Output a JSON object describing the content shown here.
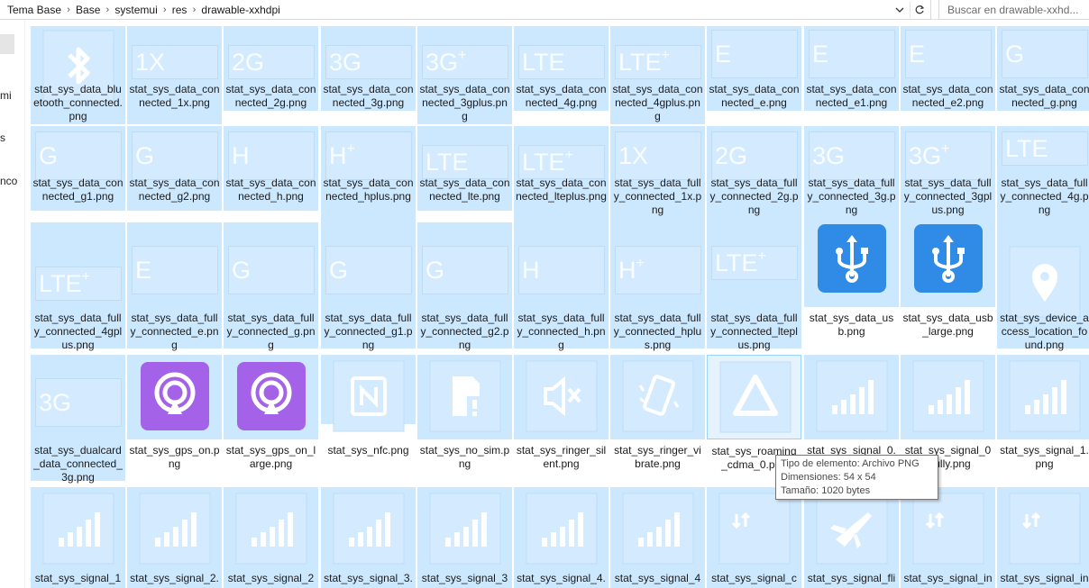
{
  "breadcrumb": [
    "Tema Base",
    "Base",
    "systemui",
    "res",
    "drawable-xxhdpi"
  ],
  "search_placeholder": "Buscar en drawable-xxhd...",
  "nav_fragments": [
    "mi",
    "s",
    "nco"
  ],
  "files": [
    {
      "name": "stat_sys_data_bluetooth_connected.png",
      "icon": "bluetooth-icon"
    },
    {
      "name": "stat_sys_data_connected_1x.png",
      "label": "1X"
    },
    {
      "name": "stat_sys_data_connected_2g.png",
      "label": "2G"
    },
    {
      "name": "stat_sys_data_connected_3g.png",
      "label": "3G"
    },
    {
      "name": "stat_sys_data_connected_3gplus.png",
      "label": "3G",
      "plus": true
    },
    {
      "name": "stat_sys_data_connected_4g.png",
      "label": "LTE"
    },
    {
      "name": "stat_sys_data_connected_4gplus.png",
      "label": "LTE",
      "plus": true
    },
    {
      "name": "stat_sys_data_connected_e.png",
      "label": "E"
    },
    {
      "name": "stat_sys_data_connected_e1.png",
      "label": "E"
    },
    {
      "name": "stat_sys_data_connected_e2.png",
      "label": "E"
    },
    {
      "name": "stat_sys_data_connected_g.png",
      "label": "G"
    },
    {
      "name": "stat_sys_data_connected_g1.png",
      "label": "G"
    },
    {
      "name": "stat_sys_data_connected_g2.png",
      "label": "G"
    },
    {
      "name": "stat_sys_data_connected_h.png",
      "label": "H"
    },
    {
      "name": "stat_sys_data_connected_hplus.png",
      "label": "H",
      "plus": true
    },
    {
      "name": "stat_sys_data_connected_lte.png",
      "label": "LTE"
    },
    {
      "name": "stat_sys_data_connected_lteplus.png",
      "label": "LTE",
      "plus": true
    },
    {
      "name": "stat_sys_data_fully_connected_1x.png",
      "label": "1X"
    },
    {
      "name": "stat_sys_data_fully_connected_2g.png",
      "label": "2G"
    },
    {
      "name": "stat_sys_data_fully_connected_3g.png",
      "label": "3G"
    },
    {
      "name": "stat_sys_data_fully_connected_3gplus.png",
      "label": "3G",
      "plus": true
    },
    {
      "name": "stat_sys_data_fully_connected_4g.png",
      "label": "LTE"
    },
    {
      "name": "stat_sys_data_fully_connected_4gplus.png",
      "label": "LTE",
      "plus": true
    },
    {
      "name": "stat_sys_data_fully_connected_e.png",
      "label": "E"
    },
    {
      "name": "stat_sys_data_fully_connected_g.png",
      "label": "G"
    },
    {
      "name": "stat_sys_data_fully_connected_g1.png",
      "label": "G"
    },
    {
      "name": "stat_sys_data_fully_connected_g2.png",
      "label": "G"
    },
    {
      "name": "stat_sys_data_fully_connected_h.png",
      "label": "H"
    },
    {
      "name": "stat_sys_data_fully_connected_hplus.png",
      "label": "H",
      "plus": true
    },
    {
      "name": "stat_sys_data_fully_connected_lteplus.png",
      "label": "LTE",
      "plus": true
    },
    {
      "name": "stat_sys_data_usb.png",
      "icon": "usb-icon"
    },
    {
      "name": "stat_sys_data_usb_large.png",
      "icon": "usb-icon"
    },
    {
      "name": "stat_sys_device_access_location_found.png",
      "icon": "location-pin-icon"
    },
    {
      "name": "stat_sys_dualcard_data_connected_3g.png",
      "label": "3G"
    },
    {
      "name": "stat_sys_gps_on.png",
      "icon": "gps-icon"
    },
    {
      "name": "stat_sys_gps_on_large.png",
      "icon": "gps-icon"
    },
    {
      "name": "stat_sys_nfc.png",
      "icon": "nfc-icon"
    },
    {
      "name": "stat_sys_no_sim.png",
      "icon": "no-sim-icon"
    },
    {
      "name": "stat_sys_ringer_silent.png",
      "icon": "speaker-mute-icon"
    },
    {
      "name": "stat_sys_ringer_vibrate.png",
      "icon": "vibrate-icon"
    },
    {
      "name": "stat_sys_roaming_cdma_0.png",
      "icon": "roaming-triangle-icon"
    },
    {
      "name": "stat_sys_signal_0.png",
      "icon": "signal-bars-icon"
    },
    {
      "name": "stat_sys_signal_0_fully.png",
      "icon": "signal-bars-icon"
    },
    {
      "name": "stat_sys_signal_1.png",
      "icon": "signal-bars-icon"
    },
    {
      "name": "stat_sys_signal_1",
      "icon": "signal-bars-icon"
    },
    {
      "name": "stat_sys_signal_2.",
      "icon": "signal-bars-icon"
    },
    {
      "name": "stat_sys_signal_2",
      "icon": "signal-bars-icon"
    },
    {
      "name": "stat_sys_signal_3.",
      "icon": "signal-bars-icon"
    },
    {
      "name": "stat_sys_signal_3",
      "icon": "signal-bars-icon"
    },
    {
      "name": "stat_sys_signal_4.",
      "icon": "signal-bars-icon"
    },
    {
      "name": "stat_sys_signal_4",
      "icon": "signal-bars-icon"
    },
    {
      "name": "stat_sys_signal_c",
      "icon": "data-arrows-icon"
    },
    {
      "name": "stat_sys_signal_fli",
      "icon": "airplane-icon"
    },
    {
      "name": "stat_sys_signal_in",
      "icon": "data-arrows-icon"
    },
    {
      "name": "stat_sys_signal_in_",
      "icon": "data-arrows-icon"
    }
  ],
  "tooltip": {
    "type": "Tipo de elemento: Archivo PNG",
    "dims": "Dimensiones: 54 x 54",
    "size": "Tamaño: 1020 bytes"
  },
  "colors": {
    "selected": "#cce8ff",
    "accent_blue": "#2f8be6",
    "gps_purple": "#a362e8"
  }
}
